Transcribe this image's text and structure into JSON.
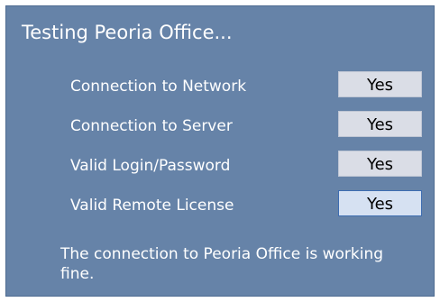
{
  "dialog": {
    "title": "Testing Peoria Office...",
    "checks": [
      {
        "label": "Connection to Network",
        "result": "Yes"
      },
      {
        "label": "Connection to Server",
        "result": "Yes"
      },
      {
        "label": "Valid Login/Password",
        "result": "Yes"
      },
      {
        "label": "Valid Remote License",
        "result": "Yes"
      }
    ],
    "message": "The connection to Peoria Office is working fine."
  },
  "colors": {
    "panel_background": "#6683a8",
    "result_box": "#dadde6",
    "focused_box_border": "#3e6db1"
  }
}
